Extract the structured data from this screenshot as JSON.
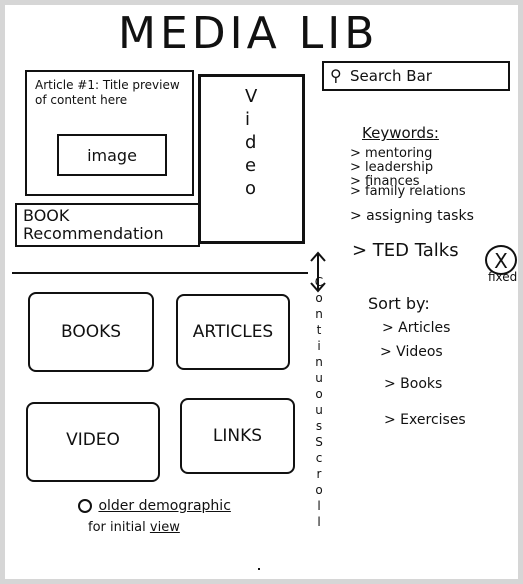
{
  "title": "MEDIA LIB",
  "article": {
    "title": "Article #1: Title preview of content here",
    "image_label": "image"
  },
  "book_rec": {
    "label": "BOOK Recommendation"
  },
  "video": {
    "letters": [
      "V",
      "i",
      "d",
      "e",
      "o"
    ]
  },
  "search": {
    "label": "Search Bar",
    "icon": "pin-icon"
  },
  "keywords": {
    "heading": "Keywords",
    "items": [
      "> mentoring",
      "> leadership",
      "> finances",
      "> family relations",
      "> assigning tasks",
      "> TED Talks"
    ]
  },
  "fixed": {
    "symbol": "X",
    "label": "fixed"
  },
  "sort": {
    "heading": "Sort by:",
    "items": [
      "> Articles",
      "> Videos",
      "> Books",
      "> Exercises"
    ]
  },
  "tiles": [
    "BOOKS",
    "ARTICLES",
    "VIDEO",
    "LINKS"
  ],
  "scroll_label": "Continuous Scroll",
  "note": {
    "line1_prefix": "older demographic",
    "line2": "for initial",
    "line2_view": "view"
  }
}
